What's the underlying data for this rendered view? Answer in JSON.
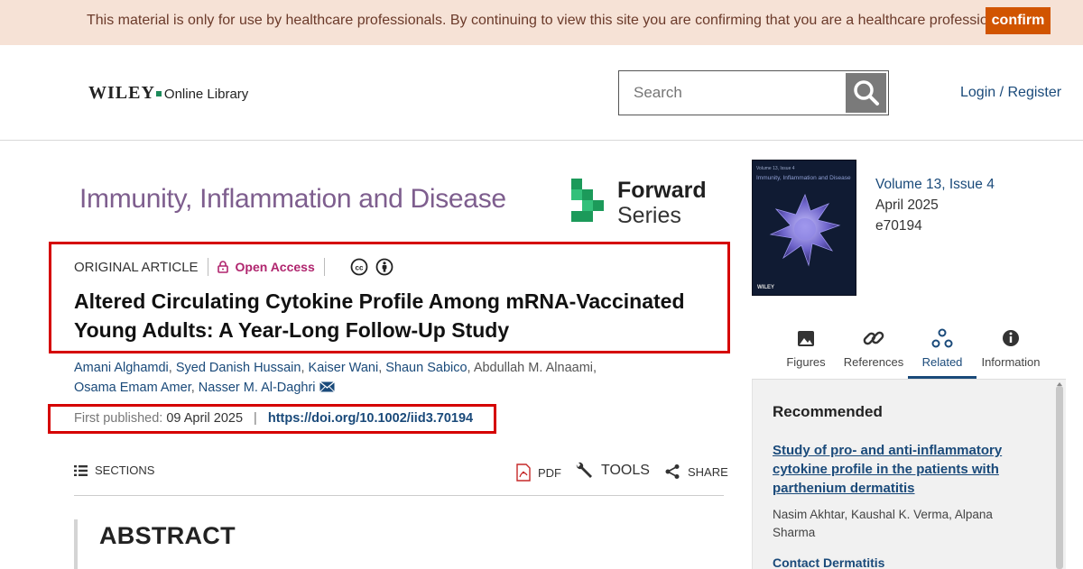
{
  "banner": {
    "text": "This material is only for use by healthcare professionals. By continuing to view this site you are confirming that you are a healthcare professional.",
    "confirm_label": "confirm"
  },
  "header": {
    "logo_wiley": "WILEY",
    "logo_library": "Online Library",
    "search_placeholder": "Search",
    "login_label": "Login / Register"
  },
  "journal": {
    "title": "Immunity, Inflammation and Disease",
    "series_line1": "Forward",
    "series_line2": "Series"
  },
  "article": {
    "type": "ORIGINAL ARTICLE",
    "access": "Open Access",
    "title": "Altered Circulating Cytokine Profile Among mRNA-Vaccinated Young Adults: A Year-Long Follow-Up Study",
    "authors": [
      "Amani Alghamdi",
      "Syed Danish Hussain",
      "Kaiser Wani",
      "Shaun Sabico",
      "Abdullah M. Alnaami",
      "Osama Emam Amer",
      "Nasser M. Al-Daghri"
    ],
    "first_published_label": "First published:",
    "first_published_date": "09 April 2025",
    "separator": "|",
    "doi": "https://doi.org/10.1002/iid3.70194"
  },
  "toolbar": {
    "sections_label": "SECTIONS",
    "pdf_label": "PDF",
    "tools_label": "TOOLS",
    "share_label": "SHARE"
  },
  "abstract_heading": "ABSTRACT",
  "issue": {
    "volume": "Volume 13, Issue 4",
    "date": "April 2025",
    "article_number": "e70194",
    "cover_title": "Immunity, Inflammation and Disease",
    "cover_publisher": "WILEY"
  },
  "tabs": [
    {
      "label": "Figures",
      "icon": "image-icon"
    },
    {
      "label": "References",
      "icon": "link-icon"
    },
    {
      "label": "Related",
      "icon": "related-icon",
      "active": true
    },
    {
      "label": "Information",
      "icon": "info-icon"
    }
  ],
  "recommended": {
    "heading": "Recommended",
    "items": [
      {
        "title": "Study of pro- and anti-inflammatory cytokine profile in the patients with parthenium dermatitis",
        "authors": "Nasim Akhtar, Kaushal K. Verma, Alpana Sharma"
      },
      {
        "title": "Contact Dermatitis"
      }
    ]
  },
  "colors": {
    "banner_bg": "#f6e2d6",
    "confirm_button": "#d15400",
    "highlight_box": "#d50000",
    "link": "#1a4a7a",
    "open_access": "#b0256e",
    "journal_title": "#7e5e8e",
    "forward_green": "#1c9a5a"
  }
}
